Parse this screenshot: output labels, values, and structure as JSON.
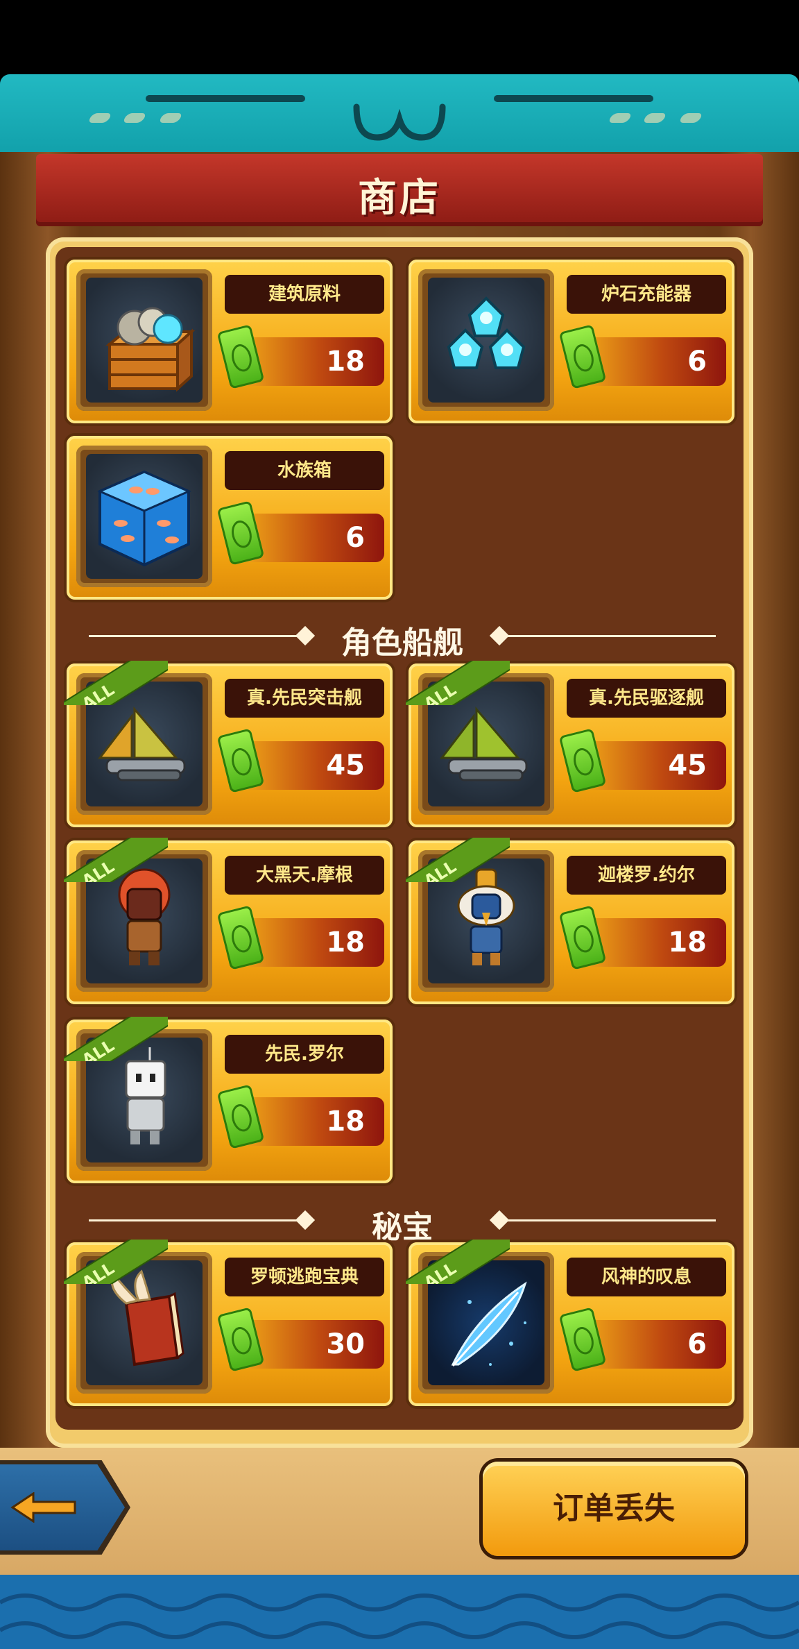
{
  "header": {
    "title": "商店"
  },
  "shop_items": [
    {
      "name": "建筑原料",
      "price": "18",
      "icon": "crate-with-stones-icon",
      "all_badge": false
    },
    {
      "name": "炉石充能器",
      "price": "6",
      "icon": "blue-crystals-icon",
      "all_badge": false
    },
    {
      "name": "水族箱",
      "price": "6",
      "icon": "aquarium-fish-cube-icon",
      "all_badge": false
    }
  ],
  "section_ships": {
    "label": "角色船舰"
  },
  "ship_items": [
    {
      "name": "真.先民突击舰",
      "price": "45",
      "icon": "sail-warship-icon",
      "badge": "ALL"
    },
    {
      "name": "真.先民驱逐舰",
      "price": "45",
      "icon": "sail-warship-icon",
      "badge": "ALL"
    },
    {
      "name": "大黑天.摩根",
      "price": "18",
      "icon": "red-haired-warrior-icon",
      "badge": "ALL"
    },
    {
      "name": "迦楼罗.约尔",
      "price": "18",
      "icon": "bird-masked-warrior-icon",
      "badge": "ALL"
    },
    {
      "name": "先民.罗尔",
      "price": "18",
      "icon": "cube-head-character-icon",
      "badge": "ALL"
    }
  ],
  "section_treasure": {
    "label": "秘宝"
  },
  "treasure_items": [
    {
      "name": "罗顿逃跑宝典",
      "price": "30",
      "icon": "winged-book-icon",
      "badge": "ALL"
    },
    {
      "name": "风神的叹息",
      "price": "6",
      "icon": "blue-feather-icon",
      "badge": "ALL"
    }
  ],
  "footer": {
    "back_icon": "arrow-left-icon",
    "order_button": "订单丢失"
  },
  "colors": {
    "teal": "#1aaeb8",
    "banner_red": "#b02a20",
    "card_gold": "#f4a511",
    "panel_brown": "#6a3417",
    "price_red": "#8e150d",
    "water_blue": "#1b6fae"
  }
}
